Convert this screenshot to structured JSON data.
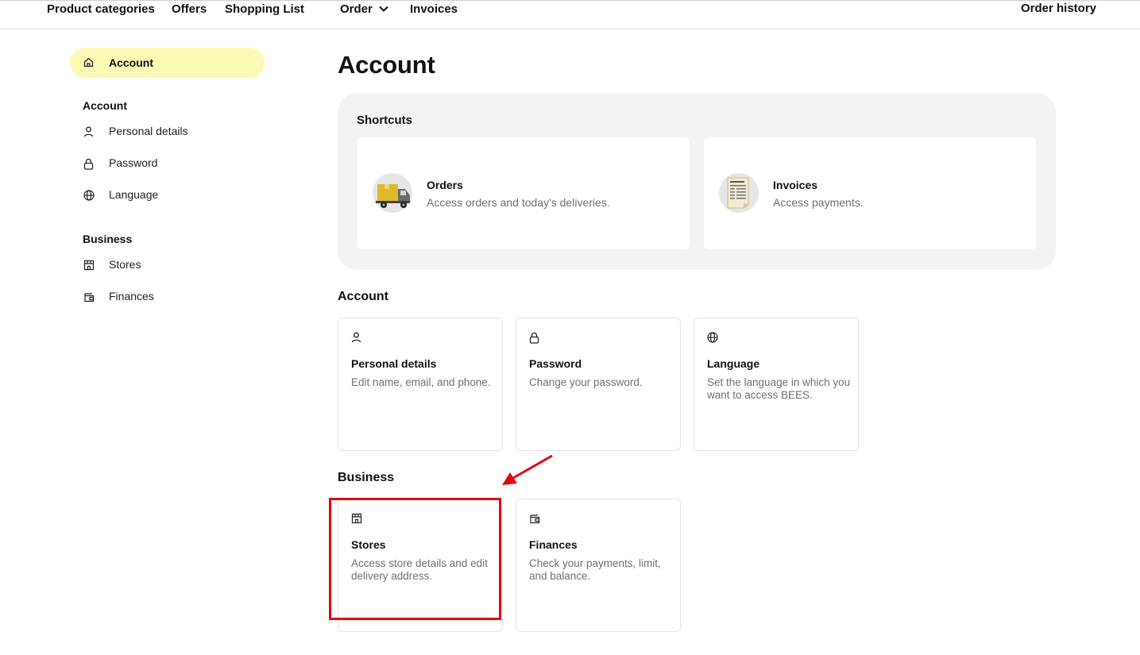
{
  "topnav": {
    "items": [
      "Product categories",
      "Offers",
      "Shopping List",
      "Order",
      "Invoices"
    ],
    "right": "Order history"
  },
  "sidebar": {
    "active": {
      "label": "Account",
      "icon": "home-icon"
    },
    "account_section": "Account",
    "account_items": [
      {
        "label": "Personal details",
        "icon": "person-icon"
      },
      {
        "label": "Password",
        "icon": "lock-icon"
      },
      {
        "label": "Language",
        "icon": "globe-icon"
      }
    ],
    "business_section": "Business",
    "business_items": [
      {
        "label": "Stores",
        "icon": "store-icon"
      },
      {
        "label": "Finances",
        "icon": "wallet-icon"
      }
    ]
  },
  "main": {
    "title": "Account",
    "shortcuts": {
      "title": "Shortcuts",
      "cards": [
        {
          "title": "Orders",
          "desc": "Access orders and today's deliveries.",
          "icon": "delivery-truck-icon"
        },
        {
          "title": "Invoices",
          "desc": "Access payments.",
          "icon": "invoice-document-icon"
        }
      ]
    },
    "account": {
      "title": "Account",
      "cards": [
        {
          "title": "Personal details",
          "desc": "Edit name, email, and phone.",
          "icon": "person-icon"
        },
        {
          "title": "Password",
          "desc": "Change your password.",
          "icon": "lock-icon"
        },
        {
          "title": "Language",
          "desc": "Set the language in which you want to access BEES.",
          "icon": "globe-icon"
        }
      ]
    },
    "business": {
      "title": "Business",
      "cards": [
        {
          "title": "Stores",
          "desc": "Access store details and edit delivery address.",
          "icon": "store-icon"
        },
        {
          "title": "Finances",
          "desc": "Check your payments, limit, and balance.",
          "icon": "wallet-icon"
        }
      ]
    }
  },
  "annotation": {
    "color": "#e30613",
    "target": "Stores"
  },
  "colors": {
    "active_highlight": "#fbf9b6",
    "shortcuts_bg": "#f3f3f3",
    "muted_text": "#707070"
  }
}
